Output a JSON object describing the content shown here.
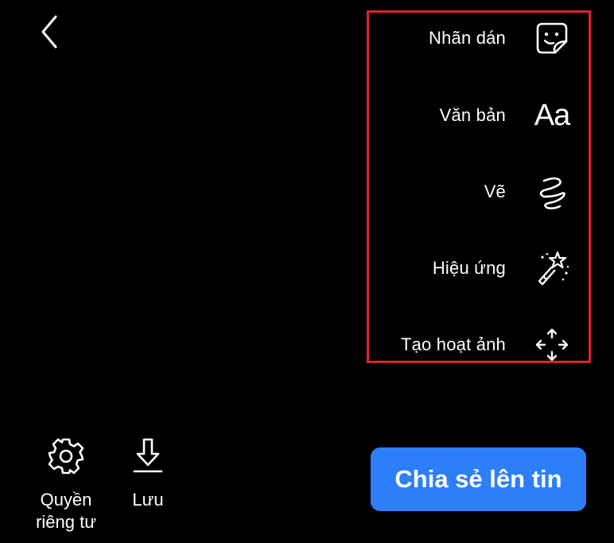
{
  "header": {
    "back_icon": "chevron-left-icon"
  },
  "tools": {
    "items": [
      {
        "label": "Nhãn dán",
        "icon": "sticker-icon"
      },
      {
        "label": "Văn bản",
        "icon": "text-icon",
        "icon_text": "Aa"
      },
      {
        "label": "Vẽ",
        "icon": "draw-icon"
      },
      {
        "label": "Hiệu ứng",
        "icon": "effects-wand-icon"
      },
      {
        "label": "Tạo hoạt ảnh",
        "icon": "animate-move-icon"
      }
    ],
    "highlight_color": "#e0202a"
  },
  "bottom": {
    "privacy": {
      "label_line1": "Quyền",
      "label_line2": "riêng tư",
      "icon": "gear-icon"
    },
    "save": {
      "label": "Lưu",
      "icon": "download-icon"
    },
    "share": {
      "label": "Chia sẻ lên tin",
      "color": "#2d7ff9"
    }
  }
}
